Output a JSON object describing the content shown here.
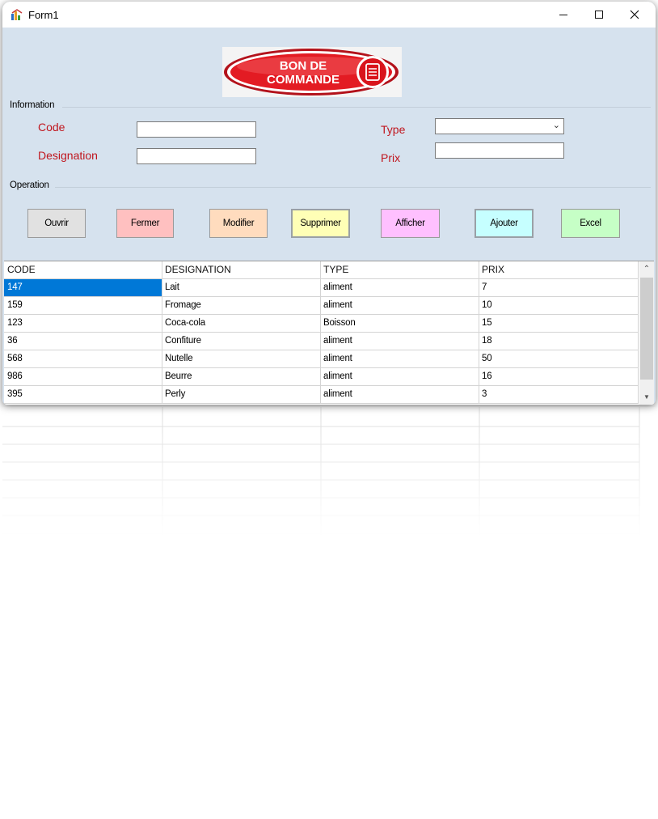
{
  "window": {
    "title": "Form1"
  },
  "logo": {
    "line1": "BON DE",
    "line2": "COMMANDE"
  },
  "information": {
    "group_label": "Information",
    "code_label": "Code",
    "designation_label": "Designation",
    "type_label": "Type",
    "prix_label": "Prix",
    "code_value": "",
    "designation_value": "",
    "type_value": "",
    "prix_value": ""
  },
  "operation": {
    "group_label": "Operation",
    "buttons": [
      {
        "label": "Ouvrir",
        "color": "#e1e1e1"
      },
      {
        "label": "Fermer",
        "color": "#ffc0c0"
      },
      {
        "label": "Modifier",
        "color": "#ffdcbe"
      },
      {
        "label": "Supprimer",
        "color": "#ffffb6"
      },
      {
        "label": "Afficher",
        "color": "#ffc0ff"
      },
      {
        "label": "Ajouter",
        "color": "#c6ffff"
      },
      {
        "label": "Excel",
        "color": "#c6ffc6"
      }
    ]
  },
  "grid": {
    "columns": [
      "CODE",
      "DESIGNATION",
      "TYPE",
      "PRIX"
    ],
    "rows": [
      [
        "147",
        "Lait",
        "aliment",
        "7"
      ],
      [
        "159",
        "Fromage",
        "aliment",
        "10"
      ],
      [
        "123",
        "Coca-cola",
        "Boisson",
        "15"
      ],
      [
        "36",
        "Confiture",
        "aliment",
        "18"
      ],
      [
        "568",
        "Nutelle",
        "aliment",
        "50"
      ],
      [
        "986",
        "Beurre",
        "aliment",
        "16"
      ],
      [
        "395",
        "Perly",
        "aliment",
        "3"
      ]
    ],
    "selected_color": "#0078d7"
  },
  "colors": {
    "label_red": "#c0161e",
    "form_bg": "#d6e2ee"
  }
}
